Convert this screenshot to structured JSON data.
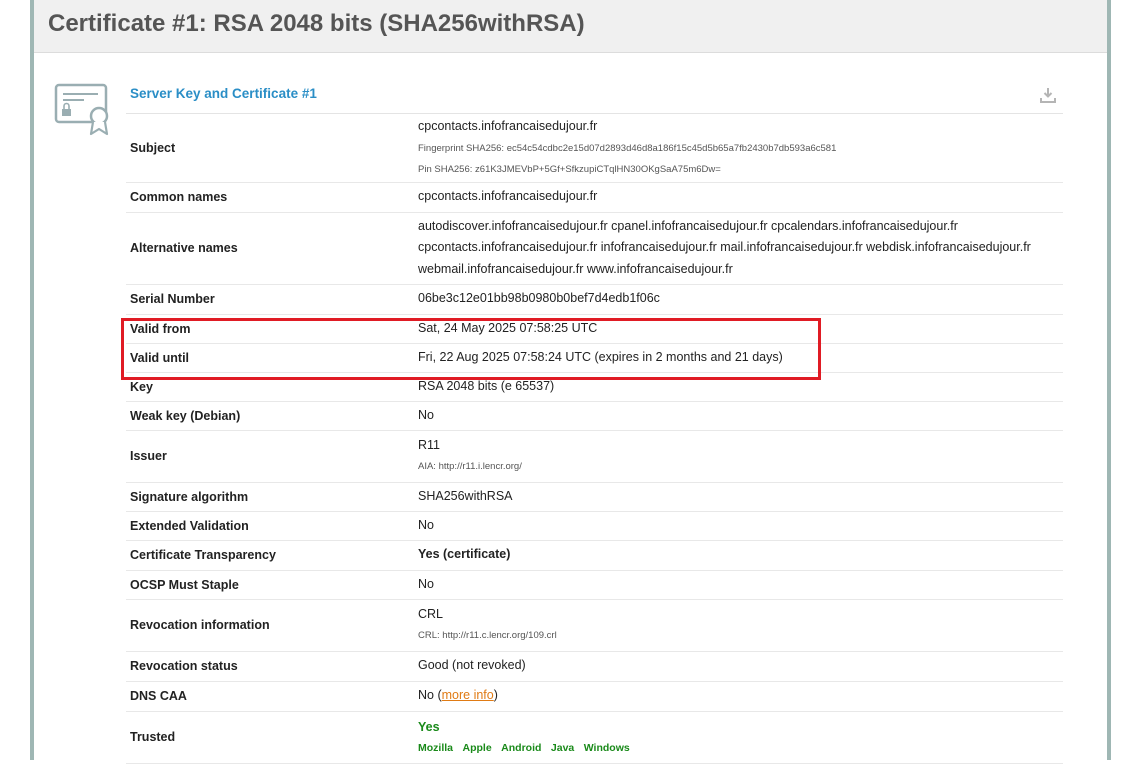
{
  "page": {
    "title": "Certificate #1: RSA 2048 bits (SHA256withRSA)"
  },
  "section": {
    "title": "Server Key and Certificate #1",
    "icons": {
      "certificate": "certificate-icon",
      "download": "download-icon"
    }
  },
  "rows": {
    "subject": {
      "label": "Subject",
      "value": "cpcontacts.infofrancaisedujour.fr",
      "fingerprint": "Fingerprint SHA256: ec54c54cdbc2e15d07d2893d46d8a186f15c45d5b65a7fb2430b7db593a6c581",
      "pin": "Pin SHA256: z61K3JMEVbP+5Gf+SfkzupiCTqlHN30OKgSaA75m6Dw="
    },
    "common_names": {
      "label": "Common names",
      "value": "cpcontacts.infofrancaisedujour.fr"
    },
    "alt_names": {
      "label": "Alternative names",
      "line1": "autodiscover.infofrancaisedujour.fr cpanel.infofrancaisedujour.fr cpcalendars.infofrancaisedujour.fr",
      "line2": "cpcontacts.infofrancaisedujour.fr infofrancaisedujour.fr mail.infofrancaisedujour.fr webdisk.infofrancaisedujour.fr",
      "line3": "webmail.infofrancaisedujour.fr www.infofrancaisedujour.fr"
    },
    "serial": {
      "label": "Serial Number",
      "value": "06be3c12e01bb98b0980b0bef7d4edb1f06c"
    },
    "valid_from": {
      "label": "Valid from",
      "value": "Sat, 24 May 2025 07:58:25 UTC"
    },
    "valid_until": {
      "label": "Valid until",
      "value": "Fri, 22 Aug 2025 07:58:24 UTC (expires in 2 months and 21 days)"
    },
    "key": {
      "label": "Key",
      "value": "RSA 2048 bits (e 65537)"
    },
    "weak_key": {
      "label": "Weak key (Debian)",
      "value": "No"
    },
    "issuer": {
      "label": "Issuer",
      "value": "R11",
      "aia": "AIA: http://r11.i.lencr.org/"
    },
    "sig_alg": {
      "label": "Signature algorithm",
      "value": "SHA256withRSA"
    },
    "ev": {
      "label": "Extended Validation",
      "value": "No"
    },
    "ct": {
      "label": "Certificate Transparency",
      "value": "Yes (certificate)"
    },
    "ocsp_staple": {
      "label": "OCSP Must Staple",
      "value": "No"
    },
    "revocation_info": {
      "label": "Revocation information",
      "value": "CRL",
      "crl": "CRL: http://r11.c.lencr.org/109.crl"
    },
    "revocation_status": {
      "label": "Revocation status",
      "value": "Good (not revoked)"
    },
    "dns_caa": {
      "label": "DNS CAA",
      "value": "No",
      "link": "more info"
    },
    "trusted": {
      "label": "Trusted",
      "value": "Yes",
      "stores": [
        "Mozilla",
        "Apple",
        "Android",
        "Java",
        "Windows"
      ]
    }
  },
  "colors": {
    "section_title": "#2a8ec6",
    "ok_green": "#1a8a1a",
    "warn_orange": "#e07b14",
    "highlight_red": "#e01b24",
    "frame_border": "#9fb7b4"
  }
}
